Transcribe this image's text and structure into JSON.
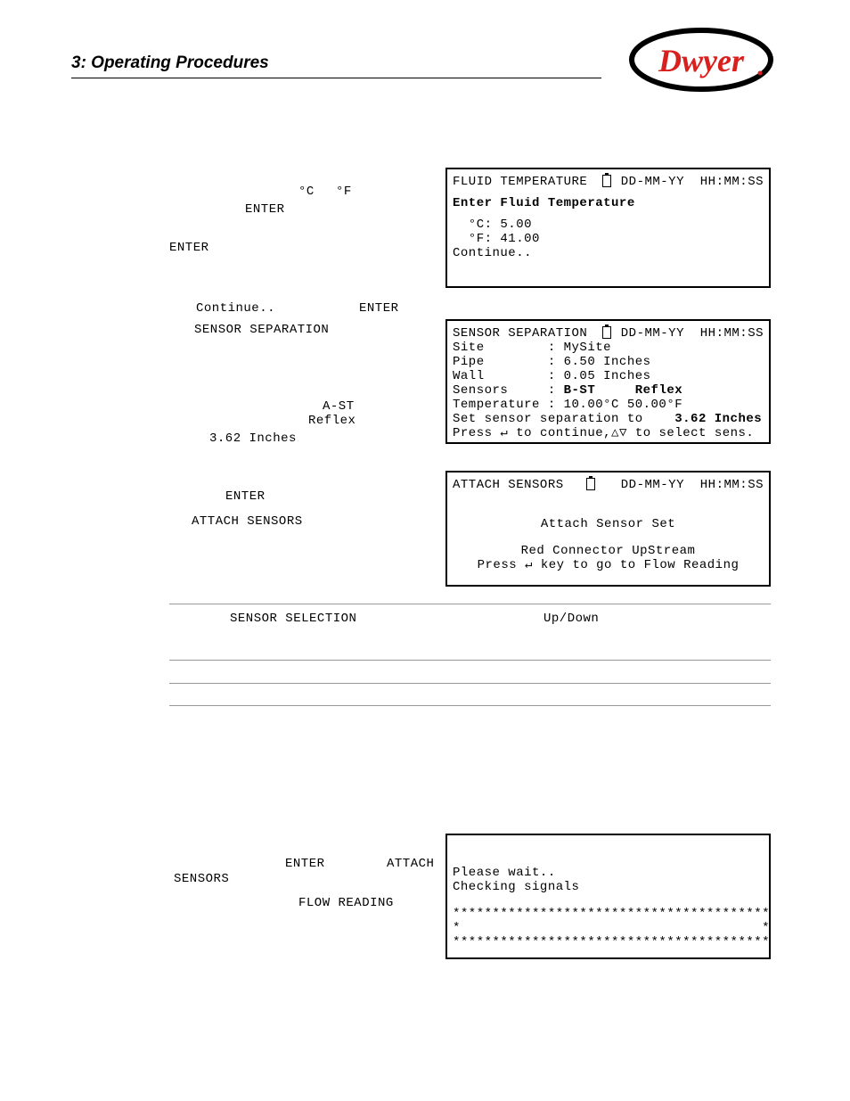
{
  "header": {
    "title": "3:  Operating Procedures"
  },
  "logo_text": "Dwyer",
  "left": {
    "block1": {
      "c": "°C",
      "f": "°F",
      "enter1": "ENTER",
      "enter2": "ENTER"
    },
    "block2": {
      "continue": "Continue..",
      "enter": "ENTER",
      "sensor_separation": "SENSOR SEPARATION",
      "ast": "A-ST",
      "reflex": "Reflex",
      "value": "3.62 Inches"
    },
    "block3": {
      "enter": "ENTER",
      "attach_sensors": "ATTACH SENSORS"
    },
    "note_row": {
      "sensor_selection": "SENSOR SELECTION",
      "updown": "Up/Down"
    },
    "block4": {
      "enter": "ENTER",
      "attach": "ATTACH",
      "sensors": "SENSORS",
      "flow_reading": "FLOW READING"
    }
  },
  "screens": {
    "fluid_temp": {
      "title": "FLUID TEMPERATURE",
      "timestamp": "DD-MM-YY  HH:MM:SS",
      "prompt": "Enter Fluid Temperature",
      "line_c": "  °C: 5.00",
      "line_f": "  °F: 41.00",
      "line_continue": "Continue.."
    },
    "sensor_sep": {
      "title": "SENSOR SEPARATION",
      "timestamp": "DD-MM-YY  HH:MM:SS",
      "site": "Site        : MySite",
      "pipe": "Pipe        : 6.50 Inches",
      "wall": "Wall        : 0.05 Inches",
      "sensors_pre": "Sensors     : ",
      "sensors_val": "B-ST",
      "sensors_post": "     ",
      "reflex": "Reflex",
      "temperature": "Temperature : 10.00°C 50.00°F",
      "set_pre": "Set sensor separation to    ",
      "set_val": "3.62 Inches",
      "press": "Press ↵ to continue,△▽ to select sens."
    },
    "attach": {
      "title": "ATTACH SENSORS",
      "timestamp": "DD-MM-YY  HH:MM:SS",
      "line1": "Attach Sensor Set",
      "line2": "Red Connector UpStream",
      "line3": "Press ↵ key to go to Flow Reading"
    },
    "wait": {
      "line1": "Please wait..",
      "line2": "Checking signals",
      "stars1": "****************************************",
      "stars2": "*                                      *",
      "stars3": "****************************************"
    }
  }
}
